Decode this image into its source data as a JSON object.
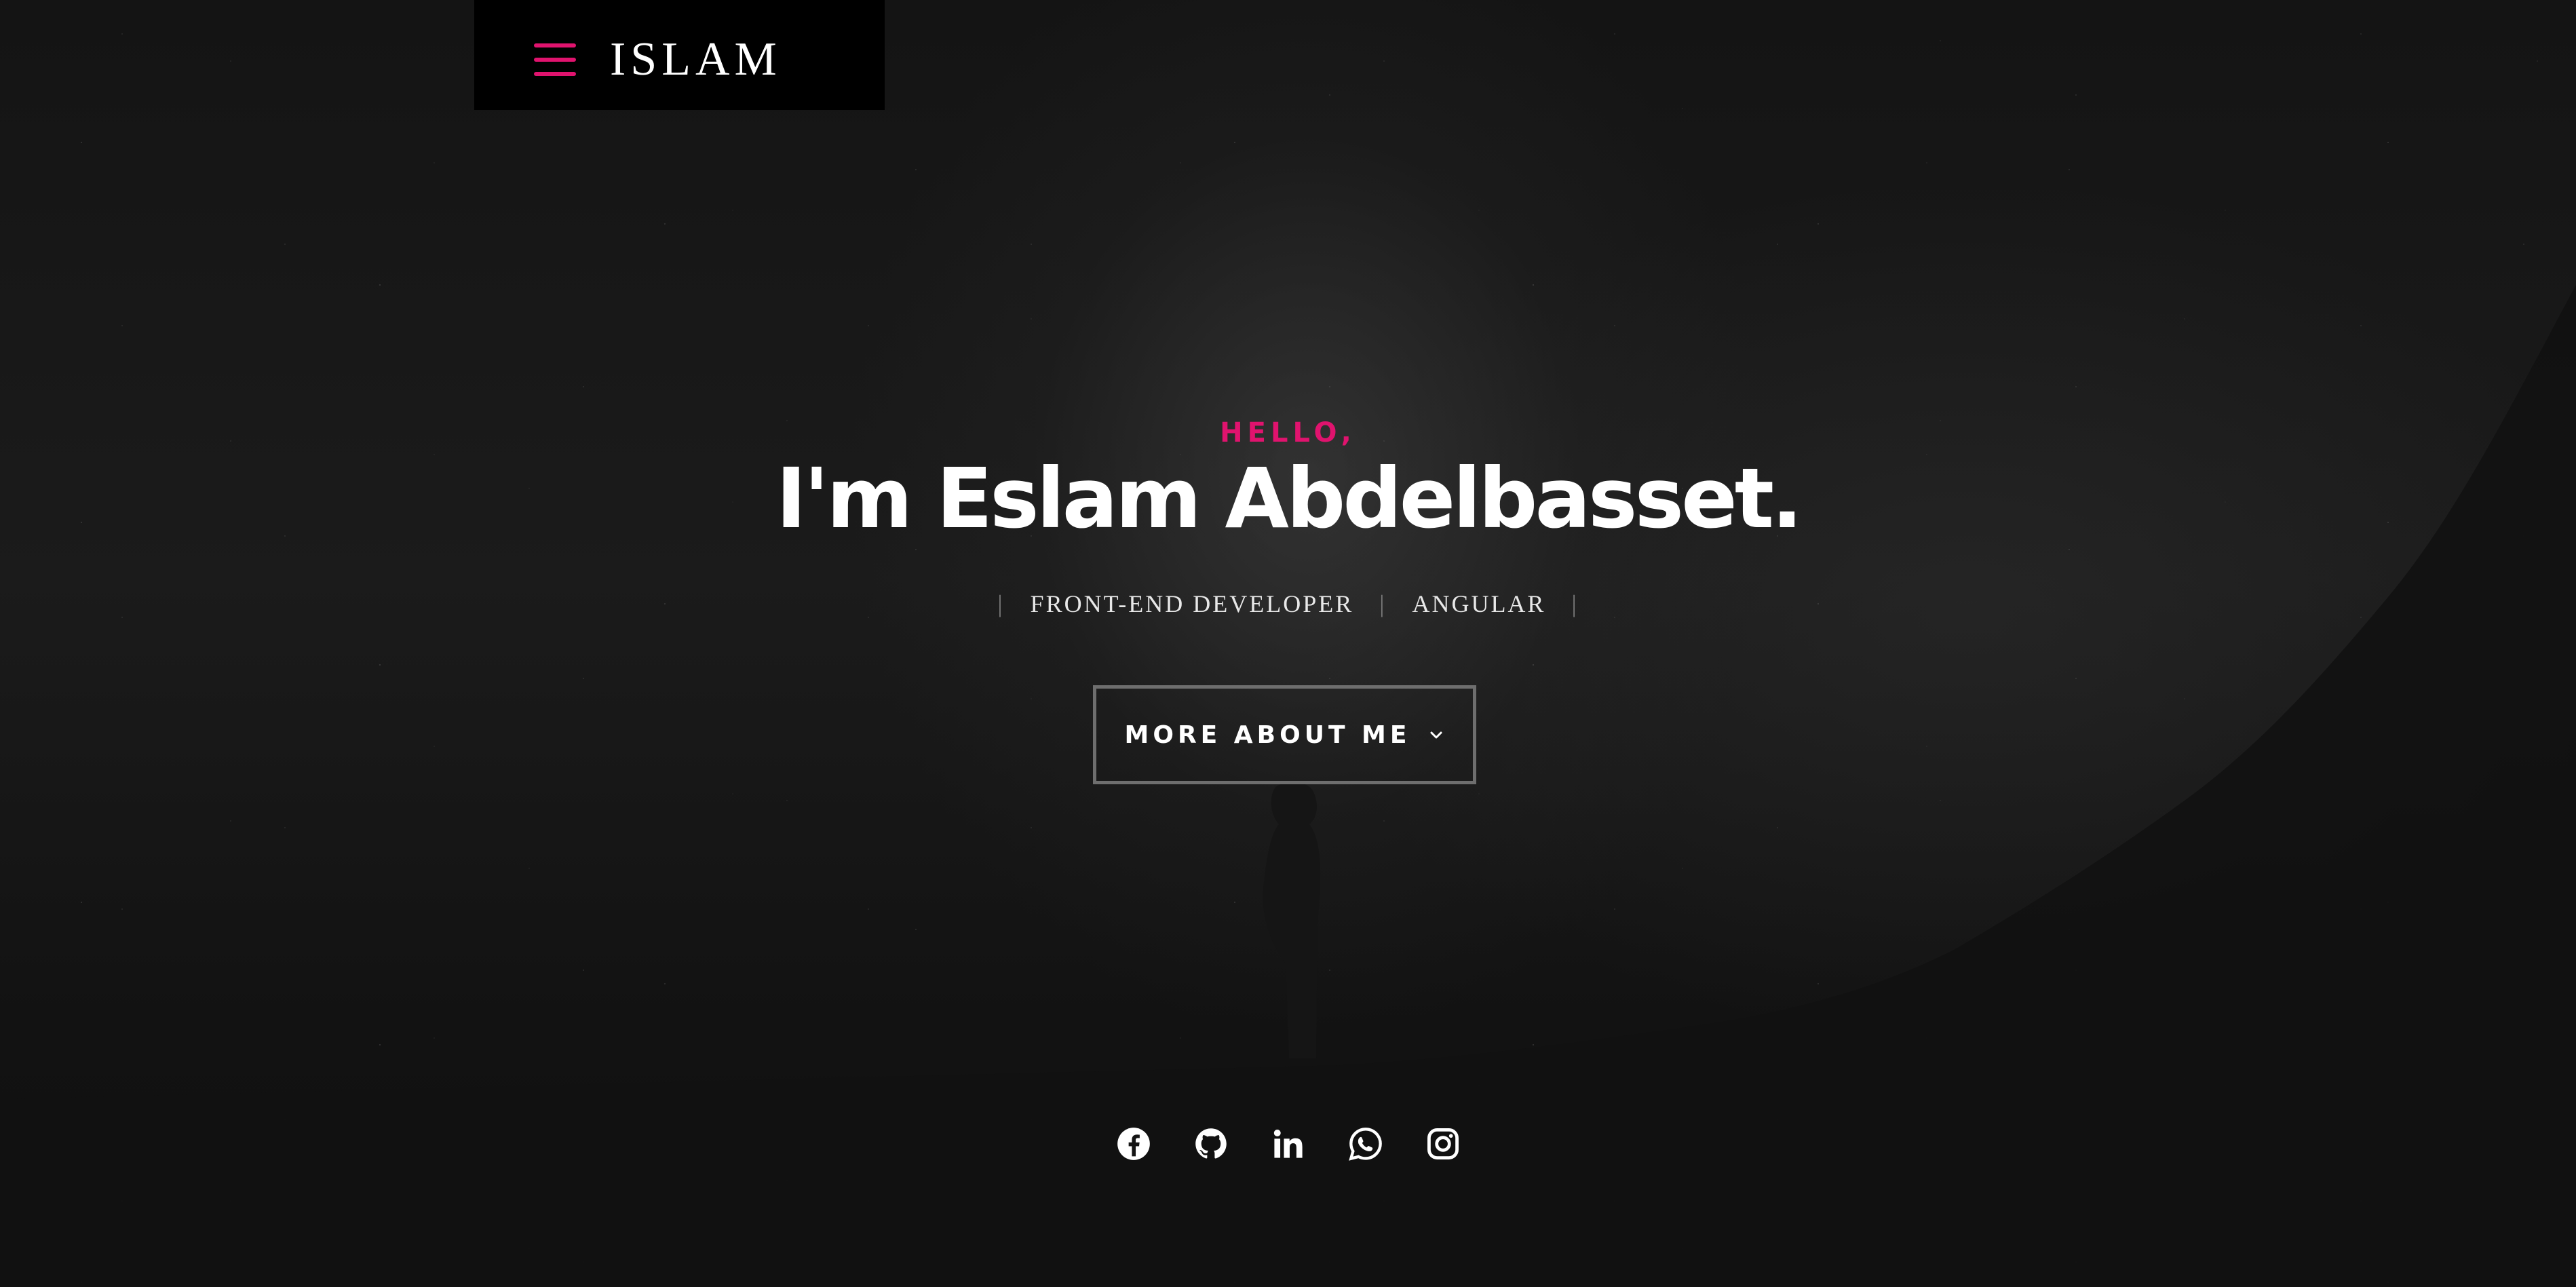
{
  "header": {
    "logo_text": "ISLAM",
    "menu_icon": "hamburger-menu-icon",
    "accent_color": "#e0136e"
  },
  "hero": {
    "greeting": "HELLO,",
    "headline": "I'm Eslam Abdelbasset.",
    "roles": [
      "FRONT-END DEVELOPER",
      "ANGULAR"
    ],
    "separator": "|",
    "cta_label": "MORE ABOUT ME",
    "cta_icon": "chevron-down-icon"
  },
  "social_links": [
    {
      "icon": "facebook-icon"
    },
    {
      "icon": "github-icon"
    },
    {
      "icon": "linkedin-icon"
    },
    {
      "icon": "whatsapp-icon"
    },
    {
      "icon": "instagram-icon"
    }
  ]
}
